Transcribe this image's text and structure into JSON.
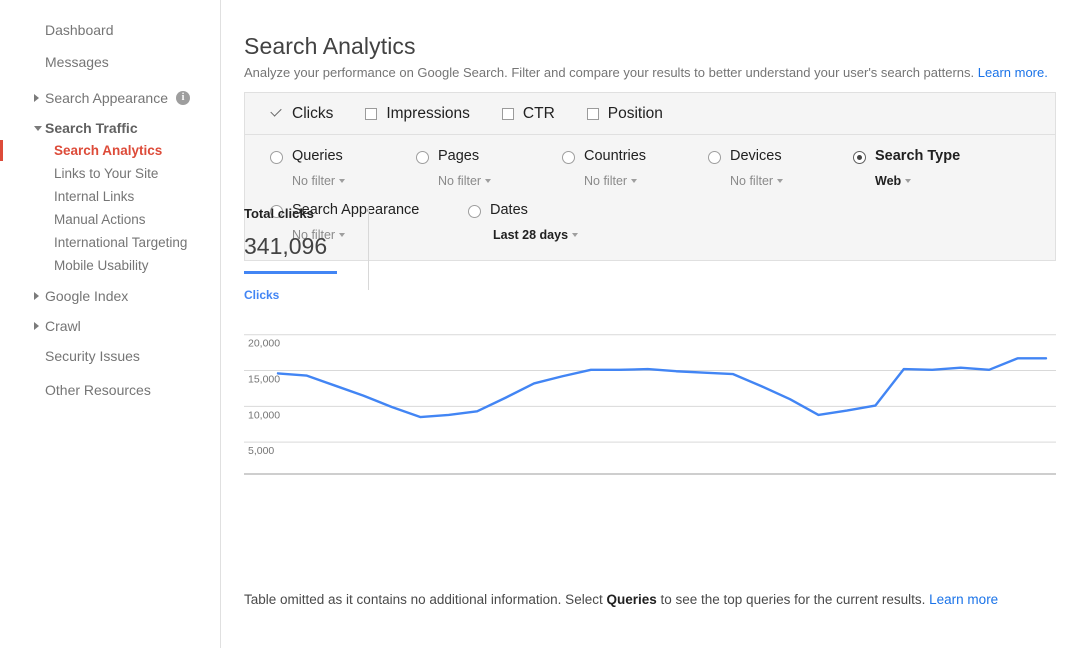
{
  "sidebar": {
    "items": [
      {
        "label": "Dashboard",
        "type": "link",
        "icon": null
      },
      {
        "label": "Messages",
        "type": "link",
        "icon": null
      },
      {
        "label": "Search Appearance",
        "type": "section-collapsed",
        "icon": "info-icon",
        "icon_glyph": "i"
      },
      {
        "label": "Search Traffic",
        "type": "section-expanded",
        "icon": null
      }
    ],
    "search_traffic_children": [
      {
        "label": "Search Analytics",
        "active": true
      },
      {
        "label": "Links to Your Site",
        "active": false
      },
      {
        "label": "Internal Links",
        "active": false
      },
      {
        "label": "Manual Actions",
        "active": false
      },
      {
        "label": "International Targeting",
        "active": false
      },
      {
        "label": "Mobile Usability",
        "active": false
      }
    ],
    "items_after": [
      {
        "label": "Google Index",
        "type": "section-collapsed"
      },
      {
        "label": "Crawl",
        "type": "section-collapsed"
      },
      {
        "label": "Security Issues",
        "type": "link"
      },
      {
        "label": "Other Resources",
        "type": "link"
      }
    ],
    "active_color": "#dd4b39"
  },
  "header": {
    "title": "Search Analytics",
    "description": "Analyze your performance on Google Search. Filter and compare your results to better understand your user's search patterns.",
    "learn_more": "Learn more.",
    "link_color": "#1a73e8"
  },
  "metrics": [
    {
      "label": "Clicks",
      "checked": true
    },
    {
      "label": "Impressions",
      "checked": false
    },
    {
      "label": "CTR",
      "checked": false
    },
    {
      "label": "Position",
      "checked": false
    }
  ],
  "filters": {
    "row1": [
      {
        "name": "Queries",
        "value": "No filter",
        "selected": false
      },
      {
        "name": "Pages",
        "value": "No filter",
        "selected": false
      },
      {
        "name": "Countries",
        "value": "No filter",
        "selected": false
      },
      {
        "name": "Devices",
        "value": "No filter",
        "selected": false
      },
      {
        "name": "Search Type",
        "value": "Web",
        "selected": true
      }
    ],
    "row2": [
      {
        "name": "Search Appearance",
        "value": "No filter",
        "selected": false
      },
      {
        "name": "Dates",
        "value": "Last 28 days",
        "selected": false,
        "value_bold": true
      }
    ]
  },
  "totals": {
    "label": "Total clicks",
    "value": "341,096",
    "accent_color": "#4285f4"
  },
  "footer": {
    "text_before": "Table omitted as it contains no additional information. Select ",
    "bold_word": "Queries",
    "text_after": " to see the top queries for the current results. ",
    "learn_more": "Learn more"
  },
  "chart_data": {
    "type": "line",
    "title": "Clicks",
    "series_name": "Clicks",
    "line_color": "#4285f4",
    "xlabel": "",
    "ylabel": "",
    "ylim": [
      2500,
      21500
    ],
    "yticks": [
      20000,
      15000,
      10000,
      5000
    ],
    "ytick_labels": [
      "20,000",
      "15,000",
      "10,000",
      "5,000"
    ],
    "grid": true,
    "legend_position": "top-left",
    "x": [
      1,
      2,
      3,
      4,
      5,
      6,
      7,
      8,
      9,
      10,
      11,
      12,
      13,
      14,
      15,
      16,
      17,
      18,
      19,
      20,
      21,
      22,
      23,
      24,
      25,
      26,
      27,
      28
    ],
    "values": [
      14600,
      14300,
      12900,
      11500,
      9900,
      8500,
      8800,
      9300,
      11200,
      13200,
      14200,
      15100,
      15100,
      15200,
      14900,
      14700,
      14500,
      12800,
      11000,
      8800,
      9400,
      10100,
      15200,
      15100,
      15400,
      15100,
      16700,
      16700
    ]
  }
}
